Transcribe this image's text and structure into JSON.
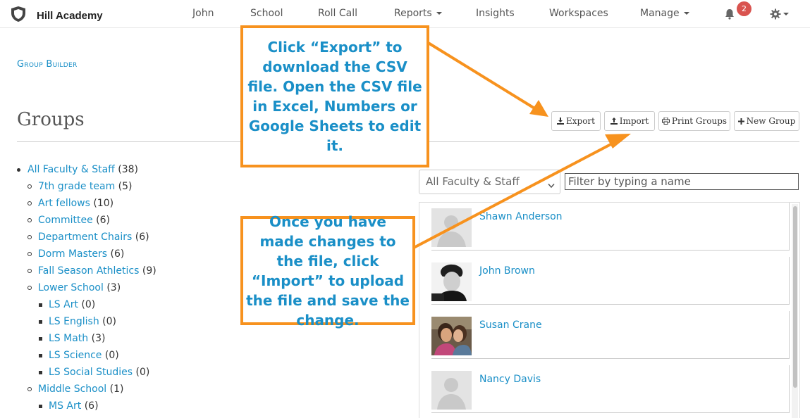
{
  "app": {
    "brand": "Hill Academy"
  },
  "nav": {
    "items": [
      {
        "label": "John",
        "dropdown": false
      },
      {
        "label": "School",
        "dropdown": false
      },
      {
        "label": "Roll Call",
        "dropdown": false
      },
      {
        "label": "Reports",
        "dropdown": true
      },
      {
        "label": "Insights",
        "dropdown": false
      },
      {
        "label": "Workspaces",
        "dropdown": false
      },
      {
        "label": "Manage",
        "dropdown": true
      }
    ],
    "notifications": {
      "icon": "bell-icon",
      "count": "2"
    },
    "settings": {
      "icon": "gear-icon"
    }
  },
  "page": {
    "breadcrumb": "Group Builder",
    "title": "Groups"
  },
  "toolbar": {
    "export_label": "Export",
    "import_label": "Import",
    "print_label": "Print Groups",
    "new_group_label": "New Group"
  },
  "tree": [
    {
      "name": "All Faculty & Staff",
      "count": "(38)",
      "level": 0
    },
    {
      "name": "7th grade team",
      "count": "(5)",
      "level": 1
    },
    {
      "name": "Art fellows",
      "count": "(10)",
      "level": 1
    },
    {
      "name": "Committee",
      "count": "(6)",
      "level": 1
    },
    {
      "name": "Department Chairs",
      "count": "(6)",
      "level": 1
    },
    {
      "name": "Dorm Masters",
      "count": "(6)",
      "level": 1
    },
    {
      "name": "Fall Season Athletics",
      "count": "(9)",
      "level": 1
    },
    {
      "name": "Lower School",
      "count": "(3)",
      "level": 1
    },
    {
      "name": "LS Art",
      "count": "(0)",
      "level": 2
    },
    {
      "name": "LS English",
      "count": "(0)",
      "level": 2
    },
    {
      "name": "LS Math",
      "count": "(3)",
      "level": 2
    },
    {
      "name": "LS Science",
      "count": "(0)",
      "level": 2
    },
    {
      "name": "LS Social Studies",
      "count": "(0)",
      "level": 2
    },
    {
      "name": "Middle School",
      "count": "(1)",
      "level": 1
    },
    {
      "name": "MS Art",
      "count": "(6)",
      "level": 2
    }
  ],
  "panel": {
    "group_select": "All Faculty & Staff",
    "filter_placeholder": "Filter by typing a name",
    "people": [
      {
        "name": "Shawn Anderson",
        "photo": "placeholder"
      },
      {
        "name": "John Brown",
        "photo": "portrait"
      },
      {
        "name": "Susan Crane",
        "photo": "portrait"
      },
      {
        "name": "Nancy Davis",
        "photo": "placeholder"
      }
    ]
  },
  "callouts": {
    "export": "Click “Export” to download the CSV file. Open the CSV file in Excel, Numbers or Google Sheets to edit it.",
    "import": "Once you have made changes to the file, click “Import” to upload the file and save the change."
  },
  "colors": {
    "accent": "#f7921e",
    "link": "#1a8fc7",
    "badge": "#d9534f"
  }
}
